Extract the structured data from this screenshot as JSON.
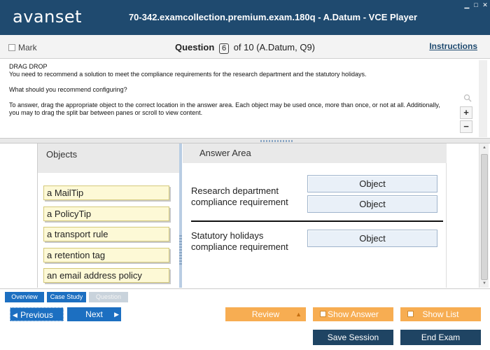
{
  "app": {
    "logo": "avanset",
    "title": "70-342.examcollection.premium.exam.180q - A.Datum - VCE Player"
  },
  "header": {
    "mark_label": "Mark",
    "question_label": "Question",
    "question_number": "6",
    "question_suffix": "of 10 (A.Datum, Q9)",
    "instructions_link": "Instructions"
  },
  "question": {
    "type": "DRAG DROP",
    "line1": "You need to recommend a solution to meet the compliance requirements for the research department and the statutory holidays.",
    "line2": "What should you recommend configuring?",
    "line3": "To answer, drag the appropriate object to the correct location in the answer area. Each object may be used once, more than once, or not at all. Additionally, you may to drag the split bar between panes or scroll to view content."
  },
  "zoom": {
    "in": "+",
    "out": "−"
  },
  "objects": {
    "title": "Objects",
    "items": [
      "a MailTip",
      "a PolicyTip",
      "a transport rule",
      "a retention tag",
      "an email address policy"
    ]
  },
  "answer_area": {
    "title": "Answer Area",
    "group1_label_line1": "Research department",
    "group1_label_line2": "compliance requirement",
    "group2_label_line1": "Statutory holidays",
    "group2_label_line2": "compliance requirement",
    "slot_label": "Object"
  },
  "tabs": {
    "overview": "Overview",
    "case_study": "Case Study",
    "question": "Question"
  },
  "nav": {
    "previous": "Previous",
    "next": "Next",
    "review": "Review",
    "show_answer": "Show Answer",
    "show_list": "Show List",
    "save_session": "Save Session",
    "end_exam": "End Exam"
  },
  "colors": {
    "titlebar": "#1f4a6f",
    "accent_blue": "#1c6fc1",
    "accent_orange": "#f7ad52",
    "object_tile": "#fdf9d6",
    "answer_slot": "#e9f0f8"
  }
}
